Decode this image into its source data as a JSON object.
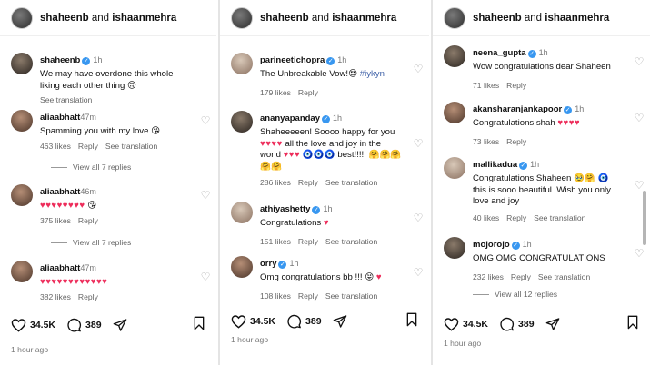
{
  "header": {
    "user1": "shaheenb",
    "and": "and",
    "user2": "ishaanmehra"
  },
  "actions": {
    "likes": "34.5K",
    "comments": "389"
  },
  "panel1": {
    "time_ago": "1 hour ago",
    "post": {
      "user": "shaheenb",
      "ago": "1h",
      "text": "We may have overdone this whole liking each other thing 🙃",
      "see_translation": "See translation"
    },
    "comments": [
      {
        "user": "aliaabhatt",
        "ago": "47m",
        "text": "Spamming you with my love",
        "emoji": "😘",
        "likes": "463 likes",
        "reply": "Reply",
        "see_translation": "See translation",
        "view_all": "View all 7 replies"
      },
      {
        "user": "aliaabhatt",
        "ago": "46m",
        "hearts": "♥♥♥♥♥♥♥♥",
        "emoji": "😘",
        "likes": "375 likes",
        "reply": "Reply",
        "view_all": "View all 7 replies"
      },
      {
        "user": "aliaabhatt",
        "ago": "47m",
        "hearts": "♥♥♥♥♥♥♥♥♥♥♥♥",
        "likes": "382 likes",
        "reply": "Reply"
      }
    ]
  },
  "panel2": {
    "time_ago": "1 hour ago",
    "comments": [
      {
        "user": "parineetichopra",
        "ago": "1h",
        "text": "The Unbreakable Vow!",
        "emoji": "😍",
        "hashtag": "#iykyn",
        "likes": "179 likes",
        "reply": "Reply"
      },
      {
        "user": "ananyapanday",
        "ago": "1h",
        "line1": "Shaheeeeen! Soooo happy for you",
        "hearts": "♥♥♥♥",
        "line2": "all the love and joy in the world",
        "hearts2": "♥♥♥",
        "eyes": "🧿🧿🧿",
        "line3": "best!!!!!",
        "emojis": "🤗🤗🤗🤗🤗",
        "likes": "286 likes",
        "reply": "Reply",
        "see_translation": "See translation"
      },
      {
        "user": "athiyashetty",
        "ago": "1h",
        "text": "Congratulations",
        "hearts": "♥",
        "likes": "151 likes",
        "reply": "Reply",
        "see_translation": "See translation"
      },
      {
        "user": "orry",
        "ago": "1h",
        "text": "Omg congratulations bb !!!",
        "emoji": "😝",
        "hearts": "♥",
        "likes": "108 likes",
        "reply": "Reply",
        "see_translation": "See translation"
      }
    ]
  },
  "panel3": {
    "time_ago": "1 hour ago",
    "comments": [
      {
        "user": "neena_gupta",
        "ago": "1h",
        "text": "Wow congratulations dear Shaheen",
        "likes": "71 likes",
        "reply": "Reply"
      },
      {
        "user": "akansharanjankapoor",
        "ago": "1h",
        "text": "Congratulations shah",
        "hearts": "♥♥♥♥",
        "likes": "73 likes",
        "reply": "Reply"
      },
      {
        "user": "mallikadua",
        "ago": "1h",
        "line1": "Congratulations Shaheen",
        "emojis": "🥹🤗",
        "eye": "🧿",
        "line2": "this is sooo beautiful. Wish you only love and joy",
        "likes": "40 likes",
        "reply": "Reply",
        "see_translation": "See translation"
      },
      {
        "user": "mojorojo",
        "ago": "1h",
        "text": "OMG OMG CONGRATULATIONS",
        "likes": "232 likes",
        "reply": "Reply",
        "see_translation": "See translation",
        "view_all": "View all 12 replies"
      }
    ]
  },
  "colors": {
    "verified": "#3897f0",
    "heart": "#ed2c5a",
    "muted": "#666666"
  },
  "icons": [
    "heart-icon",
    "comment-icon",
    "share-icon",
    "bookmark-icon",
    "verified-icon"
  ]
}
